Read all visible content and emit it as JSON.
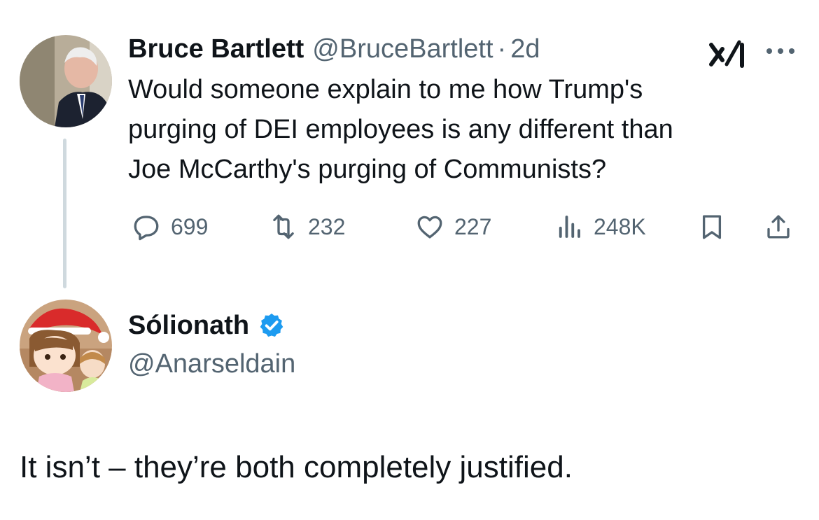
{
  "original_tweet": {
    "author_name": "Bruce Bartlett",
    "handle": "@BruceBartlett",
    "separator": "·",
    "time": "2d",
    "text_lines": [
      "Would someone explain to me how Trump's",
      "purging of DEI employees is any different than",
      "Joe McCarthy's purging of Communists?"
    ],
    "stats": {
      "replies": "699",
      "retweets": "232",
      "likes": "227",
      "views": "248K"
    }
  },
  "reply_tweet": {
    "author_name": "Sólionath",
    "handle": "@Anarseldain",
    "verified": true,
    "text": "It isn’t – they’re both completely justified."
  },
  "colors": {
    "text": "#0f1419",
    "secondary": "#536471",
    "verified": "#1d9bf0",
    "thread_line": "#cfd9de"
  },
  "icons": [
    "grok-icon",
    "more-icon",
    "reply-icon",
    "retweet-icon",
    "like-icon",
    "views-icon",
    "bookmark-icon",
    "share-icon",
    "verified-badge-icon"
  ]
}
